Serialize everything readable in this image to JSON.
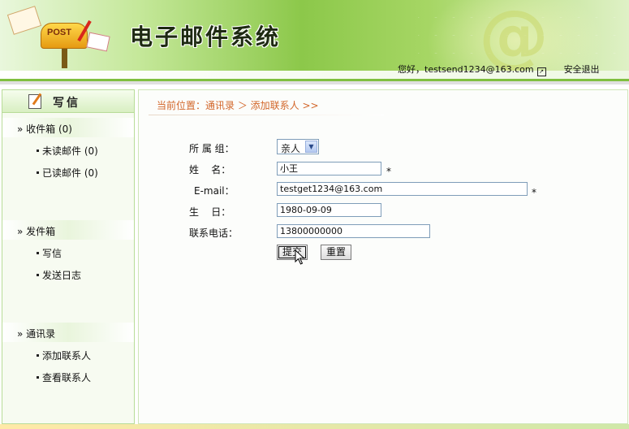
{
  "header": {
    "logo_text": "POST",
    "app_title": "电子邮件系统",
    "greeting": "您好，testsend1234@163.com",
    "logout_label": "安全退出"
  },
  "sidebar": {
    "compose_label": "写信",
    "sections": [
      {
        "label": "» 收件箱 (0)",
        "items": [
          "未读邮件 (0)",
          "已读邮件 (0)"
        ]
      },
      {
        "label": "» 发件箱",
        "items": [
          "写信",
          "发送日志"
        ]
      },
      {
        "label": "» 通讯录",
        "items": [
          "添加联系人",
          "查看联系人"
        ]
      }
    ]
  },
  "main": {
    "breadcrumb": "当前位置：通讯录 ＞ 添加联系人 >>",
    "form": {
      "group_label": "所 属 组：",
      "group_value": "亲人",
      "name_label": "姓    名：",
      "name_value": "小王",
      "email_label": "E-mail：",
      "email_value": "testget1234@163.com",
      "birthday_label": "生    日：",
      "birthday_value": "1980-09-09",
      "phone_label": "联系电话：",
      "phone_value": "13800000000",
      "required_mark": "*",
      "submit_label": "提交",
      "reset_label": "重置"
    }
  },
  "colors": {
    "accent_green": "#7fbf3f",
    "breadcrumb_orange": "#d2662a"
  },
  "icons": [
    "mailbox-logo-icon",
    "external-link-icon",
    "compose-icon",
    "dropdown-arrow-icon",
    "mouse-cursor-icon"
  ]
}
